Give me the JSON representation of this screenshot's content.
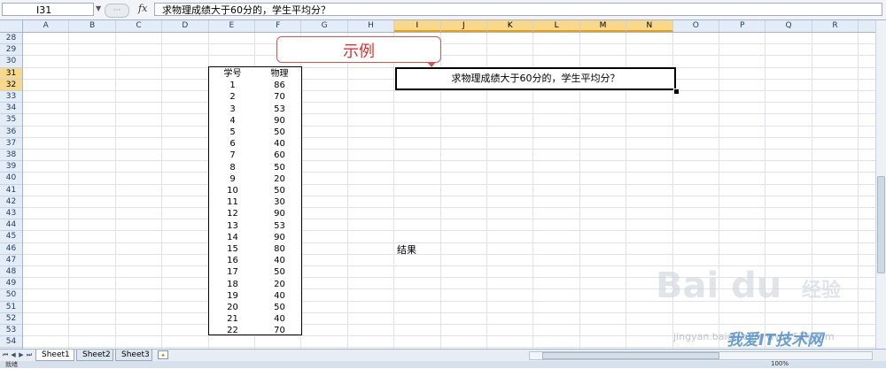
{
  "formula_bar": {
    "name_box": "I31",
    "fx": "fx",
    "formula": "求物理成绩大于60分的，学生平均分？"
  },
  "columns": [
    "A",
    "B",
    "C",
    "D",
    "E",
    "F",
    "G",
    "H",
    "I",
    "J",
    "K",
    "L",
    "M",
    "N",
    "O",
    "P",
    "Q",
    "R"
  ],
  "selected_columns": [
    "I",
    "J",
    "K",
    "L",
    "M",
    "N"
  ],
  "rows": [
    "28",
    "29",
    "30",
    "31",
    "32",
    "33",
    "34",
    "35",
    "36",
    "37",
    "38",
    "39",
    "40",
    "41",
    "42",
    "43",
    "44",
    "45",
    "46",
    "47",
    "48",
    "49",
    "50",
    "51",
    "52",
    "53",
    "54"
  ],
  "selected_rows": [
    "31",
    "32"
  ],
  "table": {
    "headers": [
      "学号",
      "物理"
    ],
    "rows": [
      [
        "1",
        "86"
      ],
      [
        "2",
        "70"
      ],
      [
        "3",
        "53"
      ],
      [
        "4",
        "90"
      ],
      [
        "5",
        "50"
      ],
      [
        "6",
        "40"
      ],
      [
        "7",
        "60"
      ],
      [
        "8",
        "50"
      ],
      [
        "9",
        "20"
      ],
      [
        "10",
        "50"
      ],
      [
        "11",
        "30"
      ],
      [
        "12",
        "90"
      ],
      [
        "13",
        "53"
      ],
      [
        "14",
        "90"
      ],
      [
        "15",
        "80"
      ],
      [
        "16",
        "40"
      ],
      [
        "17",
        "50"
      ],
      [
        "18",
        "20"
      ],
      [
        "19",
        "40"
      ],
      [
        "20",
        "50"
      ],
      [
        "21",
        "40"
      ],
      [
        "22",
        "70"
      ]
    ]
  },
  "callout": {
    "text": "示例",
    "color": "#e03030"
  },
  "question": "求物理成绩大于60分的，学生平均分？",
  "result_label": "结果",
  "sheet_tabs": [
    "Sheet1",
    "Sheet2",
    "Sheet3"
  ],
  "active_sheet": "Sheet1",
  "status": {
    "left": "就绪",
    "zoom": "100%"
  },
  "watermark": {
    "brand": "Bai du",
    "brand_cn": "经验",
    "site": "我爱IT技术网",
    "url": "jingyan.baidu.com  www.52ij.com"
  }
}
